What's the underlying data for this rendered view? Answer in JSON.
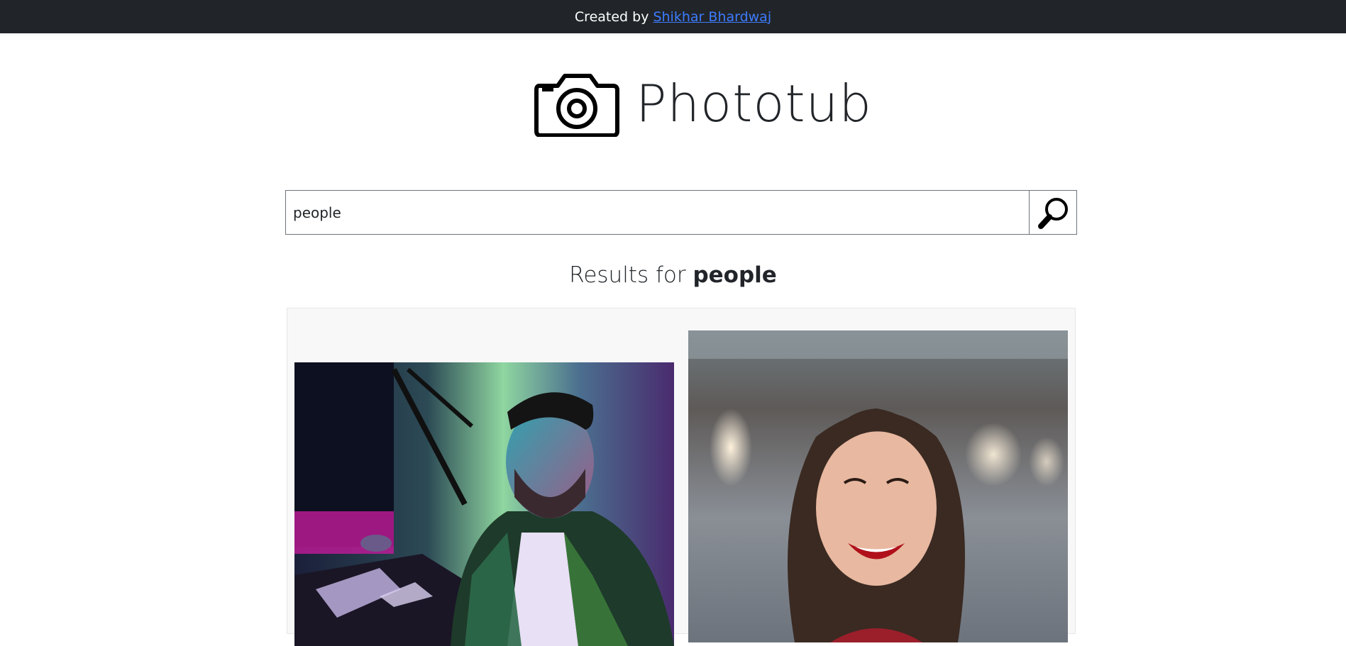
{
  "topbar": {
    "created_by": "Created by",
    "author_name": "Shikhar Bhardwaj"
  },
  "brand": {
    "name": "Phototub",
    "logo_icon": "camera-icon"
  },
  "search": {
    "value": "people",
    "button_icon": "magnifier-icon"
  },
  "results": {
    "prefix": "Results for",
    "query": "people"
  },
  "photos": [
    {
      "subject": "man at desk in neon light"
    },
    {
      "subject": "smiling woman with red lipstick"
    }
  ],
  "colors": {
    "topbar_bg": "#212529",
    "link": "#3d7bff",
    "panel_bg": "#f8f8f8"
  }
}
